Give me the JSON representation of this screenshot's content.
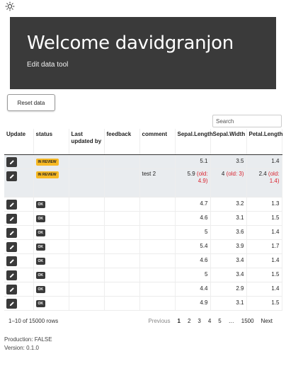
{
  "header": {
    "title": "Welcome davidgranjon",
    "subtitle": "Edit data tool"
  },
  "toolbar": {
    "reset_label": "Reset data",
    "search_placeholder": "Search"
  },
  "table": {
    "columns": [
      "Update",
      "status",
      "Last updated by",
      "feedback",
      "comment",
      "Sepal.Length",
      "Sepal.Width",
      "Petal.Length"
    ],
    "rows": [
      {
        "status": "IN REVIEW",
        "last": "",
        "feedback": "",
        "comment": "",
        "sl": "5.1",
        "sl_old": "",
        "sw": "3.5",
        "sw_old": "",
        "pl": "1.4",
        "pl_old": ""
      },
      {
        "status": "IN REVIEW",
        "last": "",
        "feedback": "",
        "comment": "test 2",
        "sl": "5.9",
        "sl_old": "(old: 4.9)",
        "sw": "4",
        "sw_old": "(old: 3)",
        "pl": "2.4",
        "pl_old": "(old: 1.4)"
      },
      {
        "status": "OK",
        "last": "",
        "feedback": "",
        "comment": "",
        "sl": "4.7",
        "sl_old": "",
        "sw": "3.2",
        "sw_old": "",
        "pl": "1.3",
        "pl_old": ""
      },
      {
        "status": "OK",
        "last": "",
        "feedback": "",
        "comment": "",
        "sl": "4.6",
        "sl_old": "",
        "sw": "3.1",
        "sw_old": "",
        "pl": "1.5",
        "pl_old": ""
      },
      {
        "status": "OK",
        "last": "",
        "feedback": "",
        "comment": "",
        "sl": "5",
        "sl_old": "",
        "sw": "3.6",
        "sw_old": "",
        "pl": "1.4",
        "pl_old": ""
      },
      {
        "status": "OK",
        "last": "",
        "feedback": "",
        "comment": "",
        "sl": "5.4",
        "sl_old": "",
        "sw": "3.9",
        "sw_old": "",
        "pl": "1.7",
        "pl_old": ""
      },
      {
        "status": "OK",
        "last": "",
        "feedback": "",
        "comment": "",
        "sl": "4.6",
        "sl_old": "",
        "sw": "3.4",
        "sw_old": "",
        "pl": "1.4",
        "pl_old": ""
      },
      {
        "status": "OK",
        "last": "",
        "feedback": "",
        "comment": "",
        "sl": "5",
        "sl_old": "",
        "sw": "3.4",
        "sw_old": "",
        "pl": "1.5",
        "pl_old": ""
      },
      {
        "status": "OK",
        "last": "",
        "feedback": "",
        "comment": "",
        "sl": "4.4",
        "sl_old": "",
        "sw": "2.9",
        "sw_old": "",
        "pl": "1.4",
        "pl_old": ""
      },
      {
        "status": "OK",
        "last": "",
        "feedback": "",
        "comment": "",
        "sl": "4.9",
        "sl_old": "",
        "sw": "3.1",
        "sw_old": "",
        "pl": "1.5",
        "pl_old": ""
      }
    ]
  },
  "footer": {
    "info": "1–10 of 15000 rows",
    "pager": {
      "previous": "Previous",
      "pages": [
        "1",
        "2",
        "3",
        "4",
        "5"
      ],
      "ellipsis": "…",
      "last": "1500",
      "next": "Next"
    }
  },
  "meta": {
    "production": "Production: FALSE",
    "version": "Version: 0.1.0"
  },
  "colors": {
    "hero_bg": "#3a3a3a",
    "review_badge": "#f7b924",
    "ok_badge": "#3a3a3a",
    "old_value": "#d9232e",
    "review_row_bg": "#e9ecef"
  },
  "icons": {
    "theme_toggle": "sun-icon",
    "edit": "pencil-icon"
  }
}
